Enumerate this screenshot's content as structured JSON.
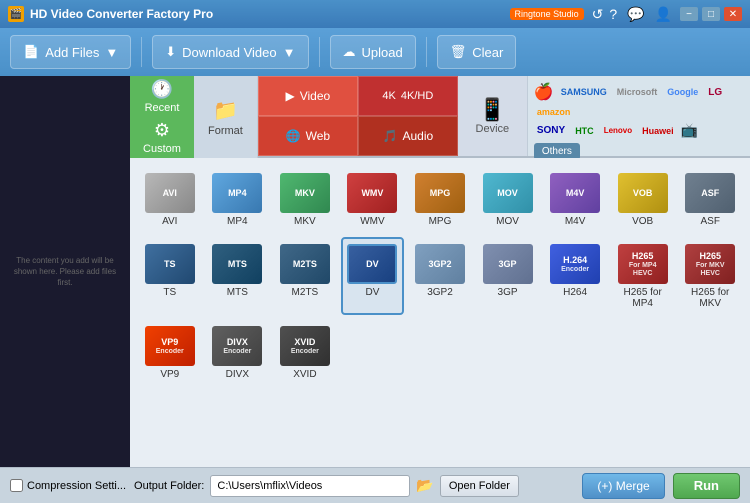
{
  "titleBar": {
    "icon": "🎬",
    "title": "HD Video Converter Factory Pro",
    "badge": "Ringtone Studio",
    "buttons": [
      "min",
      "max",
      "close"
    ]
  },
  "toolbar": {
    "addFiles": "Add Files",
    "addFilesArrow": "▼",
    "downloadVideo": "Download Video",
    "downloadArrow": "▼",
    "upload": "Upload",
    "clear": "Clear"
  },
  "formatTabs": {
    "recent": "Recent",
    "custom": "Custom",
    "format": "Format",
    "device": "Device",
    "video": "Video",
    "fourk": "4K/HD",
    "web": "Web",
    "audio": "Audio",
    "others": "Others"
  },
  "brands": [
    "Apple",
    "SAMSUNG",
    "Microsoft",
    "Google",
    "LG",
    "amazon",
    "SONY",
    "HTC",
    "Lenovo",
    "Huawei",
    "TV"
  ],
  "formats": [
    {
      "id": "avi",
      "label": "AVI",
      "colorClass": "fi-avi",
      "text": "AVI"
    },
    {
      "id": "mp4",
      "label": "MP4",
      "colorClass": "fi-mp4",
      "text": "MP4"
    },
    {
      "id": "mkv",
      "label": "MKV",
      "colorClass": "fi-mkv",
      "text": "MKV"
    },
    {
      "id": "wmv",
      "label": "WMV",
      "colorClass": "fi-wmv",
      "text": "WMV"
    },
    {
      "id": "mpg",
      "label": "MPG",
      "colorClass": "fi-mpg",
      "text": "MPG"
    },
    {
      "id": "mov",
      "label": "MOV",
      "colorClass": "fi-mov",
      "text": "MOV"
    },
    {
      "id": "m4v",
      "label": "M4V",
      "colorClass": "fi-m4v",
      "text": "M4V"
    },
    {
      "id": "vob",
      "label": "VOB",
      "colorClass": "fi-vob",
      "text": "VOB"
    },
    {
      "id": "asf",
      "label": "ASF",
      "colorClass": "fi-asf",
      "text": "ASF"
    },
    {
      "id": "ts",
      "label": "TS",
      "colorClass": "fi-ts",
      "text": "TS"
    },
    {
      "id": "mts",
      "label": "MTS",
      "colorClass": "fi-mts",
      "text": "MTS"
    },
    {
      "id": "m2ts",
      "label": "M2TS",
      "colorClass": "fi-m2ts",
      "text": "M2TS"
    },
    {
      "id": "dv",
      "label": "DV",
      "colorClass": "fi-dv",
      "text": "DV",
      "selected": true
    },
    {
      "id": "3gp2",
      "label": "3GP2",
      "colorClass": "fi-3gp2",
      "text": "3GP2"
    },
    {
      "id": "3gp",
      "label": "3GP",
      "colorClass": "fi-3gp",
      "text": "3GP"
    },
    {
      "id": "h264",
      "label": "H264",
      "colorClass": "fi-h264",
      "text": "H.264"
    },
    {
      "id": "h265mp4",
      "label": "H265 for MP4",
      "colorClass": "fi-h265mp4",
      "text": "H265"
    },
    {
      "id": "h265mkv",
      "label": "H265 for MKV",
      "colorClass": "fi-h265mkv",
      "text": "H265"
    },
    {
      "id": "vp9",
      "label": "VP9",
      "colorClass": "fi-vp9",
      "text": "VP9"
    },
    {
      "id": "divx",
      "label": "DIVX",
      "colorClass": "fi-divx",
      "text": "DIVX"
    },
    {
      "id": "xvid",
      "label": "XVID",
      "colorClass": "fi-xvid",
      "text": "XVID"
    }
  ],
  "bottomBar": {
    "compression": "Compression Setti...",
    "outputLabel": "Output Folder:",
    "outputPath": "C:\\Users\\mflix\\Videos",
    "openFolder": "Open Folder",
    "merge": "(+) Merge",
    "run": "Run"
  },
  "cursor": "🖱️"
}
